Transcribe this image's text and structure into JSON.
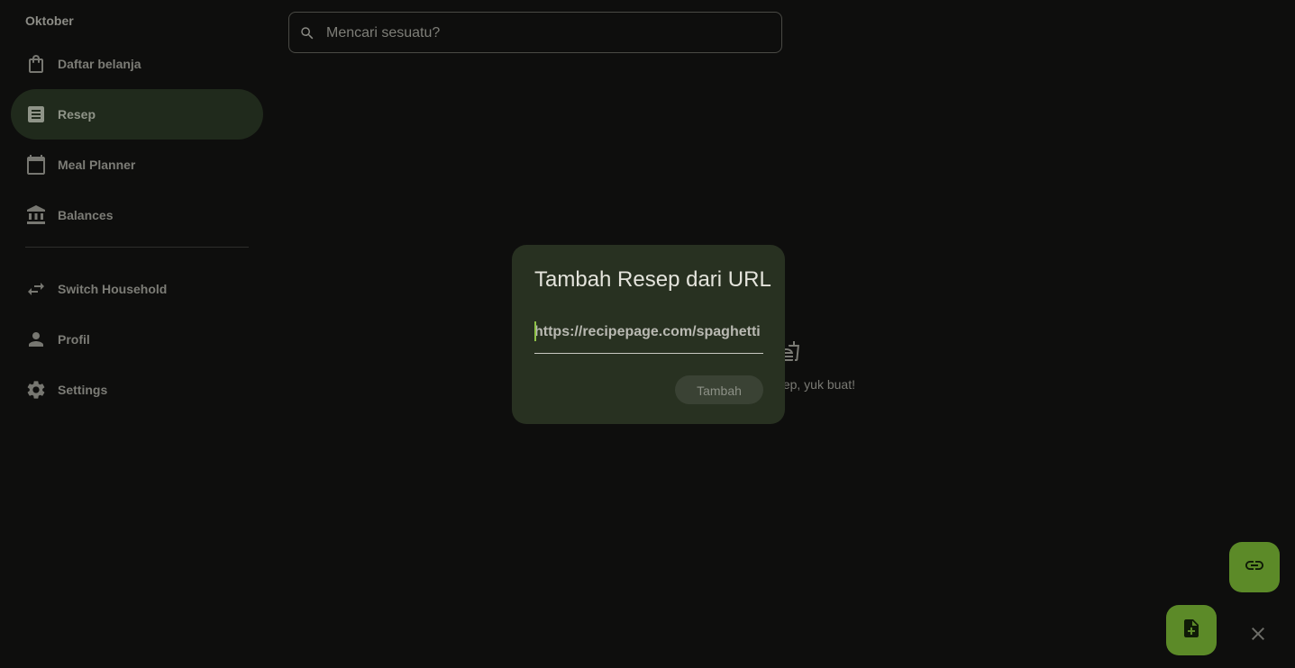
{
  "sidebar": {
    "household": "Oktober",
    "items": [
      {
        "label": "Daftar belanja",
        "icon": "shopping-bag-icon"
      },
      {
        "label": "Resep",
        "icon": "receipt-icon",
        "active": true
      },
      {
        "label": "Meal Planner",
        "icon": "calendar-icon"
      },
      {
        "label": "Balances",
        "icon": "bank-icon"
      }
    ],
    "secondary": [
      {
        "label": "Switch Household",
        "icon": "swap-icon"
      },
      {
        "label": "Profil",
        "icon": "person-icon"
      },
      {
        "label": "Settings",
        "icon": "gear-icon"
      }
    ]
  },
  "search": {
    "placeholder": "Mencari sesuatu?"
  },
  "empty_state": {
    "text_visible": "ep, yuk buat!"
  },
  "dialog": {
    "title": "Tambah Resep dari URL",
    "url_value": "https://recipepage.com/spaghetti",
    "add_label": "Tambah"
  },
  "colors": {
    "accent": "#5c8a28",
    "dialog_bg": "#283121",
    "active_nav_bg": "#202a1c"
  }
}
